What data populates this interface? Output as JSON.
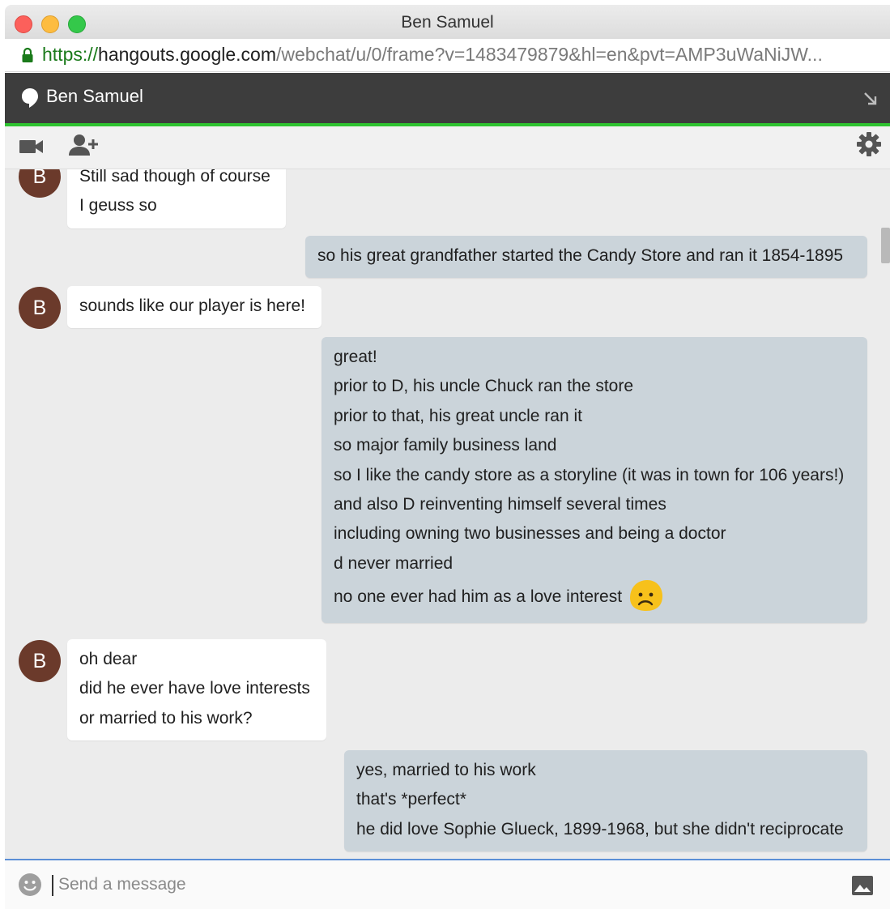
{
  "window": {
    "title": "Ben Samuel"
  },
  "address_bar": {
    "scheme": "https://",
    "host": "hangouts.google.com",
    "path": "/webchat/u/0/frame?v=1483479879&hl=en&pvt=AMP3uWaNiJW..."
  },
  "header": {
    "contact_name": "Ben Samuel",
    "accent_color": "#2ec330"
  },
  "toolbar": {
    "icons": [
      "video-call-icon",
      "add-person-icon",
      "settings-gear-icon"
    ]
  },
  "messages": [
    {
      "from": "contact",
      "avatar_letter": "B",
      "lines": [
        "Still sad though of course",
        "I geuss so"
      ]
    },
    {
      "from": "me",
      "lines": [
        "so his great grandfather started the Candy Store and ran it 1854-1895"
      ]
    },
    {
      "from": "contact",
      "avatar_letter": "B",
      "lines": [
        "sounds like our player is here!"
      ]
    },
    {
      "from": "me",
      "lines": [
        "great!",
        "prior to D, his uncle Chuck ran the store",
        "prior to that, his great uncle ran it",
        "so major family business land",
        "so I like the candy store as a storyline (it was in town for 106 years!)",
        "and also D reinventing himself several times",
        "including owning two businesses and being a doctor",
        "d never married",
        "no one ever had him as a love interest"
      ],
      "trailing_emoji": "sad-face-emoji"
    },
    {
      "from": "contact",
      "avatar_letter": "B",
      "lines": [
        "oh dear",
        "did he ever have love interests",
        "or married to his work?"
      ]
    },
    {
      "from": "me",
      "lines": [
        "yes, married to his work",
        "that's *perfect*",
        "he did love Sophie Glueck, 1899-1968, but she didn't reciprocate"
      ]
    }
  ],
  "composer": {
    "placeholder": "Send a message"
  },
  "colors": {
    "avatar": "#6b3a2b",
    "incoming_bubble": "#ffffff",
    "outgoing_bubble": "#cbd4da",
    "chat_background": "#ececec"
  }
}
